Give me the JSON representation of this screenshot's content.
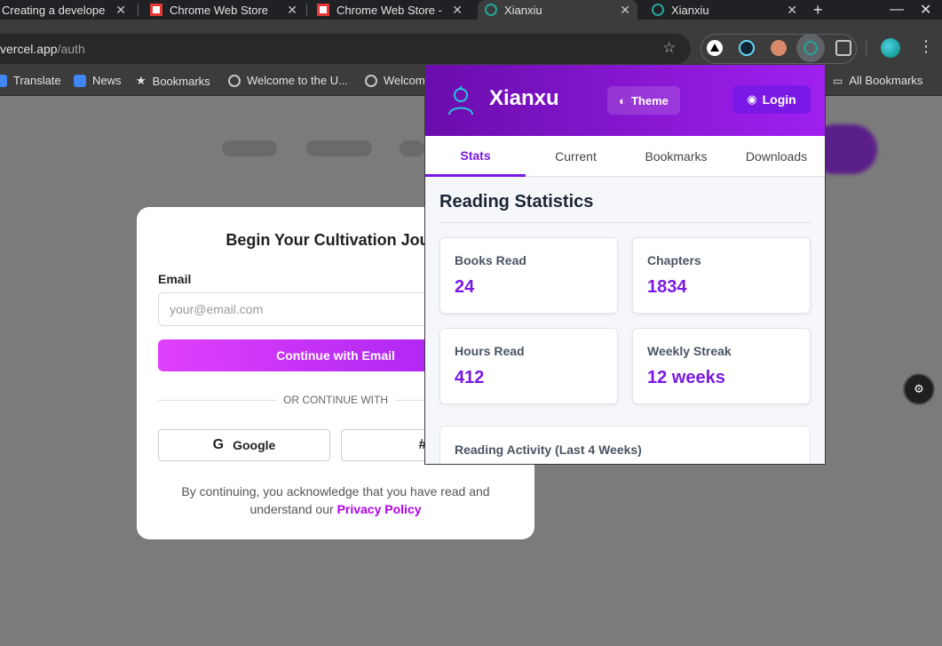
{
  "tabs": [
    {
      "title": "Creating a develope",
      "favicon_color": "#1f1f1f"
    },
    {
      "title": "Chrome Web Store",
      "favicon_color": "#e53935"
    },
    {
      "title": "Chrome Web Store -",
      "favicon_color": "#e53935"
    },
    {
      "title": "Xianxiu",
      "favicon_color": "#26a69a",
      "active": true
    },
    {
      "title": "Xianxiu",
      "favicon_color": "#26a69a"
    }
  ],
  "window_controls": {
    "minimize": "—",
    "maximize": "☐",
    "close": "✕",
    "new_tab": "+"
  },
  "omnibox": {
    "host": "vercel.app",
    "path": "/auth"
  },
  "bookmarks": [
    {
      "label": "Translate",
      "icon": "translate-icon"
    },
    {
      "label": "News",
      "icon": "news-icon"
    },
    {
      "label": "Bookmarks",
      "icon": "star-icon"
    },
    {
      "label": "Welcome to the U...",
      "icon": "globe-icon"
    },
    {
      "label": "Welcom",
      "icon": "globe-icon"
    },
    {
      "label": "All Bookmarks",
      "icon": "folder-icon"
    }
  ],
  "auth_card": {
    "heading": "Begin Your Cultivation Journ",
    "email_label": "Email",
    "email_placeholder": "your@email.com",
    "continue_button": "Continue with Email",
    "divider_text": "OR CONTINUE WITH",
    "google_button": "Google",
    "disclaimer_text": "By continuing, you acknowledge that you have read and understand our",
    "privacy_link": "Privacy Policy"
  },
  "popup": {
    "app_name": "Xianxu",
    "theme_button": "Theme",
    "login_button": "Login",
    "tabs": [
      "Stats",
      "Current",
      "Bookmarks",
      "Downloads"
    ],
    "active_tab": "Stats",
    "section_title": "Reading Statistics",
    "stats": [
      {
        "label": "Books Read",
        "value": "24"
      },
      {
        "label": "Chapters",
        "value": "1834"
      },
      {
        "label": "Hours Read",
        "value": "412"
      },
      {
        "label": "Weekly Streak",
        "value": "12 weeks"
      }
    ],
    "activity_title": "Reading Activity (Last 4 Weeks)"
  },
  "colors": {
    "accent": "#7a19e6",
    "header_gradient_start": "#6a0dad",
    "header_gradient_end": "#a020f0",
    "link": "#b100e8"
  }
}
